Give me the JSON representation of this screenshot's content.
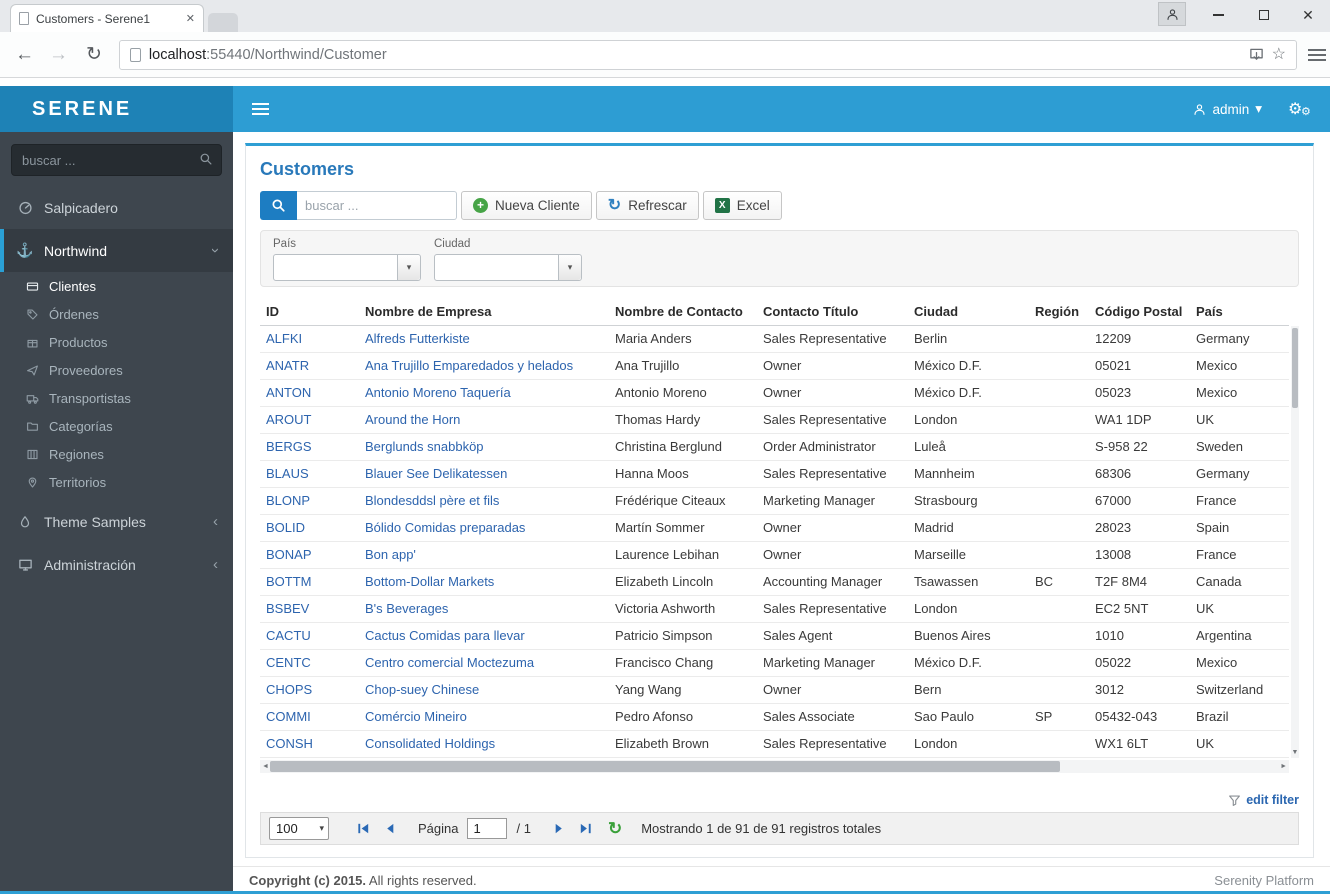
{
  "icons": {
    "close": "✕",
    "back_arrow": "←",
    "forward_arrow": "→",
    "refresh": "↻",
    "star": "☆",
    "gear": "⚙",
    "caret_down": "▾",
    "chevron_left": "‹",
    "chevron_right": "›",
    "anchor": "⚓",
    "plus": "+",
    "excel_x": "X",
    "scroll_up_down": "▼",
    "scroll_left": "◄",
    "scroll_right": "►"
  },
  "browser": {
    "tab_title": "Customers - Serene1",
    "url_host": "localhost",
    "url_path": ":55440/Northwind/Customer"
  },
  "header": {
    "logo": "SERENE",
    "user": "admin"
  },
  "sidebar": {
    "search_placeholder": "buscar ...",
    "dashboard": "Salpicadero",
    "northwind": "Northwind",
    "northwind_children": [
      "Clientes",
      "Órdenes",
      "Productos",
      "Proveedores",
      "Transportistas",
      "Categorías",
      "Regiones",
      "Territorios"
    ],
    "theme_samples": "Theme Samples",
    "administration": "Administración"
  },
  "main": {
    "title": "Customers",
    "toolbar": {
      "search_placeholder": "buscar ...",
      "add_label": "Nueva Cliente",
      "refresh_label": "Refrescar",
      "excel_label": "Excel"
    },
    "filters": {
      "country_label": "País",
      "city_label": "Ciudad"
    },
    "grid": {
      "columns": [
        "ID",
        "Nombre de Empresa",
        "Nombre de Contacto",
        "Contacto Título",
        "Ciudad",
        "Región",
        "Código Postal",
        "País"
      ],
      "rows": [
        {
          "id": "ALFKI",
          "company": "Alfreds Futterkiste",
          "contact": "Maria Anders",
          "title": "Sales Representative",
          "city": "Berlin",
          "region": "",
          "postal": "12209",
          "country": "Germany"
        },
        {
          "id": "ANATR",
          "company": "Ana Trujillo Emparedados y helados",
          "contact": "Ana Trujillo",
          "title": "Owner",
          "city": "México D.F.",
          "region": "",
          "postal": "05021",
          "country": "Mexico"
        },
        {
          "id": "ANTON",
          "company": "Antonio Moreno Taquería",
          "contact": "Antonio Moreno",
          "title": "Owner",
          "city": "México D.F.",
          "region": "",
          "postal": "05023",
          "country": "Mexico"
        },
        {
          "id": "AROUT",
          "company": "Around the Horn",
          "contact": "Thomas Hardy",
          "title": "Sales Representative",
          "city": "London",
          "region": "",
          "postal": "WA1 1DP",
          "country": "UK"
        },
        {
          "id": "BERGS",
          "company": "Berglunds snabbköp",
          "contact": "Christina Berglund",
          "title": "Order Administrator",
          "city": "Luleå",
          "region": "",
          "postal": "S-958 22",
          "country": "Sweden"
        },
        {
          "id": "BLAUS",
          "company": "Blauer See Delikatessen",
          "contact": "Hanna Moos",
          "title": "Sales Representative",
          "city": "Mannheim",
          "region": "",
          "postal": "68306",
          "country": "Germany"
        },
        {
          "id": "BLONP",
          "company": "Blondesddsl père et fils",
          "contact": "Frédérique Citeaux",
          "title": "Marketing Manager",
          "city": "Strasbourg",
          "region": "",
          "postal": "67000",
          "country": "France"
        },
        {
          "id": "BOLID",
          "company": "Bólido Comidas preparadas",
          "contact": "Martín Sommer",
          "title": "Owner",
          "city": "Madrid",
          "region": "",
          "postal": "28023",
          "country": "Spain"
        },
        {
          "id": "BONAP",
          "company": "Bon app'",
          "contact": "Laurence Lebihan",
          "title": "Owner",
          "city": "Marseille",
          "region": "",
          "postal": "13008",
          "country": "France"
        },
        {
          "id": "BOTTM",
          "company": "Bottom-Dollar Markets",
          "contact": "Elizabeth Lincoln",
          "title": "Accounting Manager",
          "city": "Tsawassen",
          "region": "BC",
          "postal": "T2F 8M4",
          "country": "Canada"
        },
        {
          "id": "BSBEV",
          "company": "B's Beverages",
          "contact": "Victoria Ashworth",
          "title": "Sales Representative",
          "city": "London",
          "region": "",
          "postal": "EC2 5NT",
          "country": "UK"
        },
        {
          "id": "CACTU",
          "company": "Cactus Comidas para llevar",
          "contact": "Patricio Simpson",
          "title": "Sales Agent",
          "city": "Buenos Aires",
          "region": "",
          "postal": "1010",
          "country": "Argentina"
        },
        {
          "id": "CENTC",
          "company": "Centro comercial Moctezuma",
          "contact": "Francisco Chang",
          "title": "Marketing Manager",
          "city": "México D.F.",
          "region": "",
          "postal": "05022",
          "country": "Mexico"
        },
        {
          "id": "CHOPS",
          "company": "Chop-suey Chinese",
          "contact": "Yang Wang",
          "title": "Owner",
          "city": "Bern",
          "region": "",
          "postal": "3012",
          "country": "Switzerland"
        },
        {
          "id": "COMMI",
          "company": "Comércio Mineiro",
          "contact": "Pedro Afonso",
          "title": "Sales Associate",
          "city": "Sao Paulo",
          "region": "SP",
          "postal": "05432-043",
          "country": "Brazil"
        },
        {
          "id": "CONSH",
          "company": "Consolidated Holdings",
          "contact": "Elizabeth Brown",
          "title": "Sales Representative",
          "city": "London",
          "region": "",
          "postal": "WX1 6LT",
          "country": "UK"
        }
      ]
    },
    "edit_filter_label": "edit filter",
    "pager": {
      "page_size": "100",
      "page_label": "Página",
      "page_value": "1",
      "page_total": "/ 1",
      "status": "Mostrando 1 de 91 de 91 registros totales"
    }
  },
  "footer": {
    "copyright_bold": "Copyright (c) 2015.",
    "copyright_rest": " All rights reserved.",
    "right": "Serenity Platform"
  }
}
